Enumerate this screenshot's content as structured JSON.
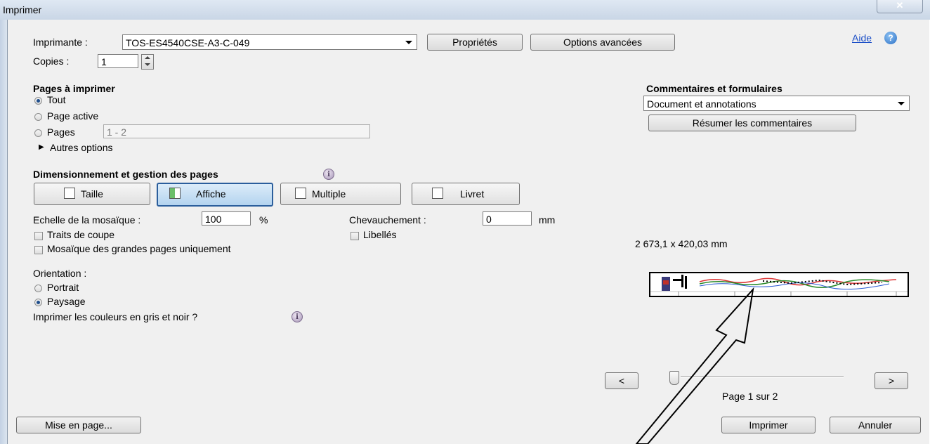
{
  "window": {
    "title": "Imprimer",
    "close_glyph": "✕"
  },
  "printer": {
    "label": "Imprimante :",
    "value": "TOS-ES4540CSE-A3-C-049",
    "properties_button": "Propriétés",
    "advanced_button": "Options avancées"
  },
  "help": {
    "label": "Aide",
    "icon": "help-icon"
  },
  "copies": {
    "label": "Copies :",
    "value": "1"
  },
  "pages_to_print": {
    "heading": "Pages à imprimer",
    "all": "Tout",
    "current": "Page active",
    "pages": "Pages",
    "pages_value": "1 - 2",
    "more_options": "Autres options",
    "selected": "Tout"
  },
  "comments": {
    "heading": "Commentaires et formulaires",
    "value": "Document et annotations",
    "summarize_button": "Résumer les commentaires"
  },
  "sizing": {
    "heading": "Dimensionnement et gestion des pages",
    "buttons": {
      "size": "Taille",
      "poster": "Affiche",
      "multiple": "Multiple",
      "booklet": "Livret"
    },
    "selected": "Affiche"
  },
  "poster": {
    "tile_scale_label": "Echelle de la mosaïque :",
    "tile_scale_value": "100",
    "tile_scale_unit": "%",
    "overlap_label": "Chevauchement :",
    "overlap_value": "0",
    "overlap_unit": "mm",
    "cut_marks": "Traits de coupe",
    "labels": "Libellés",
    "tile_large_only": "Mosaïque des grandes pages uniquement"
  },
  "orientation": {
    "label": "Orientation :",
    "portrait": "Portrait",
    "landscape": "Paysage",
    "selected": "Paysage"
  },
  "grayscale_label": "Imprimer les couleurs en gris et noir ?",
  "preview": {
    "dimensions": "2 673,1 x 420,03 mm",
    "page_status": "Page 1 sur 2",
    "prev_glyph": "<",
    "next_glyph": ">"
  },
  "footer": {
    "page_setup_button": "Mise en page...",
    "print_button": "Imprimer",
    "cancel_button": "Annuler"
  }
}
